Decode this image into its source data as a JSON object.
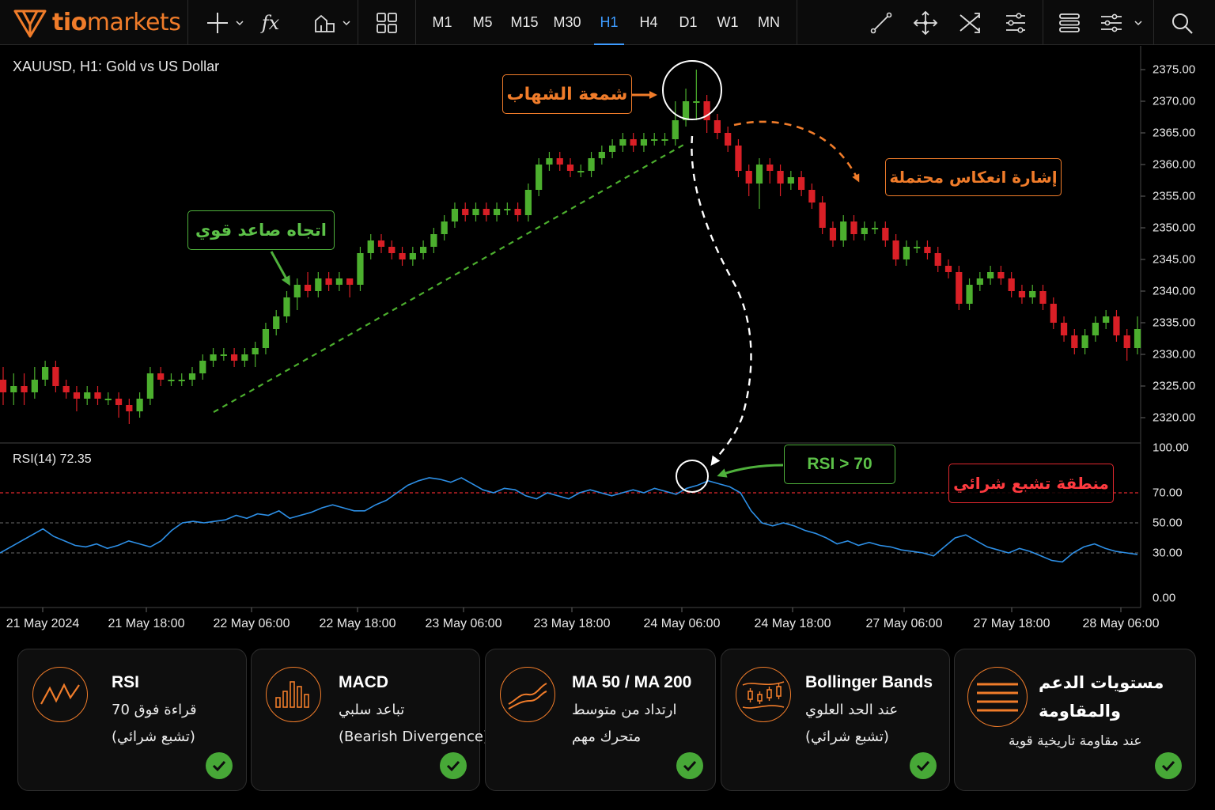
{
  "toolbar": {
    "logo_prefix": "tio",
    "logo_suffix": "markets",
    "fx_label": "fx",
    "timeframes": [
      "M1",
      "M5",
      "M15",
      "M30",
      "H1",
      "H4",
      "D1",
      "W1",
      "MN"
    ],
    "active_timeframe": "H1"
  },
  "chart": {
    "symbol_title": "XAUUSD, H1:   Gold vs US Dollar",
    "rsi_label": "RSI(14) 72.35",
    "price_axis": [
      "2375.00",
      "2370.00",
      "2365.00",
      "2360.00",
      "2355.00",
      "2350.00",
      "2345.00",
      "2340.00",
      "2335.00",
      "2330.00",
      "2325.00",
      "2320.00"
    ],
    "rsi_axis": [
      "100.00",
      "70.00",
      "50.00",
      "30.00",
      "0.00"
    ],
    "time_axis": [
      "21 May 2024",
      "21 May 18:00",
      "22 May 06:00",
      "22 May 18:00",
      "23 May 06:00",
      "23 May 18:00",
      "24 May 06:00",
      "24 May 18:00",
      "27 May 06:00",
      "27 May 18:00",
      "28 May 06:00"
    ],
    "colors": {
      "bull": "#4caf2e",
      "bear": "#d91f26",
      "rsi_line": "#2d8fe6",
      "overbought": "#e0282e",
      "accent": "#f07c2a"
    }
  },
  "annotations": {
    "shooting_star": "شمعة الشهاب",
    "reversal_signal": "إشارة انعكاس محتملة",
    "strong_uptrend": "اتجاه صاعد قوي",
    "rsi_over_70": "RSI > 70",
    "overbought_zone": "منطقة تشبع شرائي"
  },
  "cards": [
    {
      "title": "RSI",
      "line1": "قراءة فوق 70",
      "line2": "(تشبع شرائي)",
      "icon": "rsi-line-icon"
    },
    {
      "title": "MACD",
      "line1": "تباعد سلبي",
      "line2": "(Bearish Divergence)",
      "icon": "macd-bars-icon"
    },
    {
      "title": "MA 50 / MA 200",
      "line1": "ارتداد من متوسط",
      "line2": "متحرك مهم",
      "icon": "moving-average-icon"
    },
    {
      "title": "Bollinger Bands",
      "line1": "عند الحد العلوي",
      "line2": "(تشبع شرائي)",
      "icon": "bollinger-candles-icon"
    },
    {
      "title": "مستويات الدعم",
      "title2": "والمقاومة",
      "line1": "عند مقاومة تاريخية قوية",
      "icon": "support-resistance-lines-icon"
    }
  ],
  "chart_data": {
    "type": "candlestick",
    "symbol": "XAUUSD",
    "timeframe": "H1",
    "ylim_price": [
      2317,
      2378
    ],
    "rsi_period": 14,
    "rsi_value": 72.35,
    "rsi_levels": [
      30,
      50,
      70
    ],
    "ylim_rsi": [
      0,
      100
    ],
    "candles": [
      [
        2326,
        2324,
        2328,
        2322
      ],
      [
        2324,
        2325,
        2327,
        2322
      ],
      [
        2325,
        2324,
        2327,
        2322
      ],
      [
        2324,
        2326,
        2328,
        2323
      ],
      [
        2326,
        2328,
        2329,
        2325
      ],
      [
        2328,
        2325,
        2329,
        2324
      ],
      [
        2325,
        2324,
        2326,
        2323
      ],
      [
        2324,
        2323,
        2325,
        2321
      ],
      [
        2323,
        2324,
        2325,
        2322
      ],
      [
        2324,
        2323,
        2325,
        2322
      ],
      [
        2323,
        2323,
        2324,
        2322
      ],
      [
        2323,
        2322,
        2324,
        2320
      ],
      [
        2322,
        2321,
        2323,
        2319
      ],
      [
        2321,
        2323,
        2324,
        2320
      ],
      [
        2323,
        2327,
        2328,
        2322
      ],
      [
        2327,
        2326,
        2328,
        2325
      ],
      [
        2326,
        2326,
        2327,
        2325
      ],
      [
        2326,
        2326,
        2327,
        2325
      ],
      [
        2326,
        2327,
        2328,
        2325
      ],
      [
        2327,
        2329,
        2330,
        2326
      ],
      [
        2329,
        2330,
        2331,
        2328
      ],
      [
        2330,
        2330,
        2331,
        2329
      ],
      [
        2330,
        2329,
        2331,
        2328
      ],
      [
        2329,
        2330,
        2331,
        2328
      ],
      [
        2330,
        2331,
        2332,
        2328
      ],
      [
        2331,
        2334,
        2335,
        2330
      ],
      [
        2334,
        2336,
        2337,
        2333
      ],
      [
        2336,
        2339,
        2340,
        2335
      ],
      [
        2339,
        2341,
        2342,
        2337
      ],
      [
        2341,
        2340,
        2343,
        2339
      ],
      [
        2340,
        2342,
        2343,
        2339
      ],
      [
        2342,
        2341,
        2343,
        2340
      ],
      [
        2341,
        2342,
        2343,
        2340
      ],
      [
        2342,
        2341,
        2342,
        2339
      ],
      [
        2341,
        2346,
        2347,
        2340
      ],
      [
        2346,
        2348,
        2349,
        2345
      ],
      [
        2348,
        2347,
        2349,
        2346
      ],
      [
        2347,
        2346,
        2348,
        2345
      ],
      [
        2346,
        2345,
        2347,
        2344
      ],
      [
        2345,
        2346,
        2347,
        2344
      ],
      [
        2346,
        2347,
        2348,
        2345
      ],
      [
        2347,
        2349,
        2350,
        2346
      ],
      [
        2349,
        2351,
        2352,
        2348
      ],
      [
        2351,
        2353,
        2354,
        2350
      ],
      [
        2353,
        2352,
        2354,
        2351
      ],
      [
        2352,
        2353,
        2354,
        2351
      ],
      [
        2353,
        2352,
        2354,
        2351
      ],
      [
        2352,
        2353,
        2354,
        2351
      ],
      [
        2353,
        2353,
        2354,
        2352
      ],
      [
        2353,
        2352,
        2354,
        2351
      ],
      [
        2352,
        2356,
        2357,
        2351
      ],
      [
        2356,
        2360,
        2361,
        2355
      ],
      [
        2360,
        2361,
        2362,
        2359
      ],
      [
        2361,
        2360,
        2362,
        2359
      ],
      [
        2360,
        2359,
        2361,
        2358
      ],
      [
        2359,
        2359,
        2360,
        2358
      ],
      [
        2359,
        2361,
        2362,
        2358
      ],
      [
        2361,
        2362,
        2363,
        2360
      ],
      [
        2362,
        2363,
        2364,
        2361
      ],
      [
        2363,
        2364,
        2365,
        2362
      ],
      [
        2364,
        2363,
        2365,
        2362
      ],
      [
        2363,
        2364,
        2365,
        2362
      ],
      [
        2364,
        2364,
        2365,
        2363
      ],
      [
        2364,
        2364,
        2365,
        2363
      ],
      [
        2364,
        2367,
        2370,
        2363
      ],
      [
        2367,
        2370,
        2372,
        2366
      ],
      [
        2370,
        2370,
        2375,
        2367
      ],
      [
        2370,
        2367,
        2371,
        2365
      ],
      [
        2367,
        2365,
        2368,
        2364
      ],
      [
        2365,
        2363,
        2366,
        2362
      ],
      [
        2363,
        2359,
        2364,
        2358
      ],
      [
        2359,
        2357,
        2360,
        2355
      ],
      [
        2357,
        2360,
        2361,
        2353
      ],
      [
        2360,
        2359,
        2361,
        2357
      ],
      [
        2359,
        2357,
        2360,
        2355
      ],
      [
        2357,
        2358,
        2359,
        2356
      ],
      [
        2358,
        2356,
        2359,
        2355
      ],
      [
        2356,
        2354,
        2357,
        2353
      ],
      [
        2354,
        2350,
        2355,
        2349
      ],
      [
        2350,
        2348,
        2351,
        2347
      ],
      [
        2348,
        2351,
        2352,
        2347
      ],
      [
        2351,
        2349,
        2352,
        2348
      ],
      [
        2349,
        2350,
        2351,
        2348
      ],
      [
        2350,
        2350,
        2351,
        2349
      ],
      [
        2350,
        2348,
        2351,
        2347
      ],
      [
        2348,
        2345,
        2349,
        2344
      ],
      [
        2345,
        2347,
        2348,
        2344
      ],
      [
        2347,
        2347,
        2348,
        2346
      ],
      [
        2347,
        2346,
        2348,
        2345
      ],
      [
        2346,
        2344,
        2347,
        2343
      ],
      [
        2344,
        2343,
        2345,
        2342
      ],
      [
        2343,
        2338,
        2344,
        2337
      ],
      [
        2338,
        2341,
        2342,
        2337
      ],
      [
        2341,
        2342,
        2343,
        2340
      ],
      [
        2342,
        2343,
        2344,
        2341
      ],
      [
        2343,
        2342,
        2344,
        2341
      ],
      [
        2342,
        2340,
        2343,
        2339
      ],
      [
        2340,
        2339,
        2341,
        2338
      ],
      [
        2339,
        2340,
        2341,
        2338
      ],
      [
        2340,
        2338,
        2341,
        2337
      ],
      [
        2338,
        2335,
        2339,
        2334
      ],
      [
        2335,
        2333,
        2336,
        2332
      ],
      [
        2333,
        2331,
        2334,
        2330
      ],
      [
        2331,
        2333,
        2334,
        2330
      ],
      [
        2333,
        2335,
        2336,
        2332
      ],
      [
        2335,
        2336,
        2337,
        2334
      ],
      [
        2336,
        2333,
        2337,
        2332
      ],
      [
        2333,
        2331,
        2334,
        2329
      ],
      [
        2331,
        2334,
        2336,
        2330
      ]
    ],
    "rsi_values": [
      30,
      34,
      38,
      42,
      46,
      41,
      38,
      35,
      34,
      36,
      33,
      35,
      38,
      36,
      34,
      38,
      45,
      50,
      51,
      50,
      51,
      52,
      55,
      53,
      56,
      55,
      58,
      53,
      55,
      57,
      60,
      62,
      60,
      58,
      58,
      62,
      65,
      70,
      75,
      78,
      80,
      79,
      77,
      80,
      76,
      72,
      70,
      73,
      72,
      68,
      66,
      70,
      68,
      66,
      70,
      72,
      70,
      68,
      70,
      72,
      70,
      73,
      71,
      69,
      73,
      75,
      78,
      76,
      74,
      70,
      58,
      50,
      48,
      50,
      48,
      45,
      43,
      40,
      36,
      38,
      35,
      37,
      35,
      34,
      32,
      31,
      30,
      28,
      34,
      40,
      42,
      38,
      34,
      32,
      30,
      33,
      31,
      28,
      25,
      24,
      30,
      34,
      36,
      33,
      31,
      30,
      29
    ]
  }
}
